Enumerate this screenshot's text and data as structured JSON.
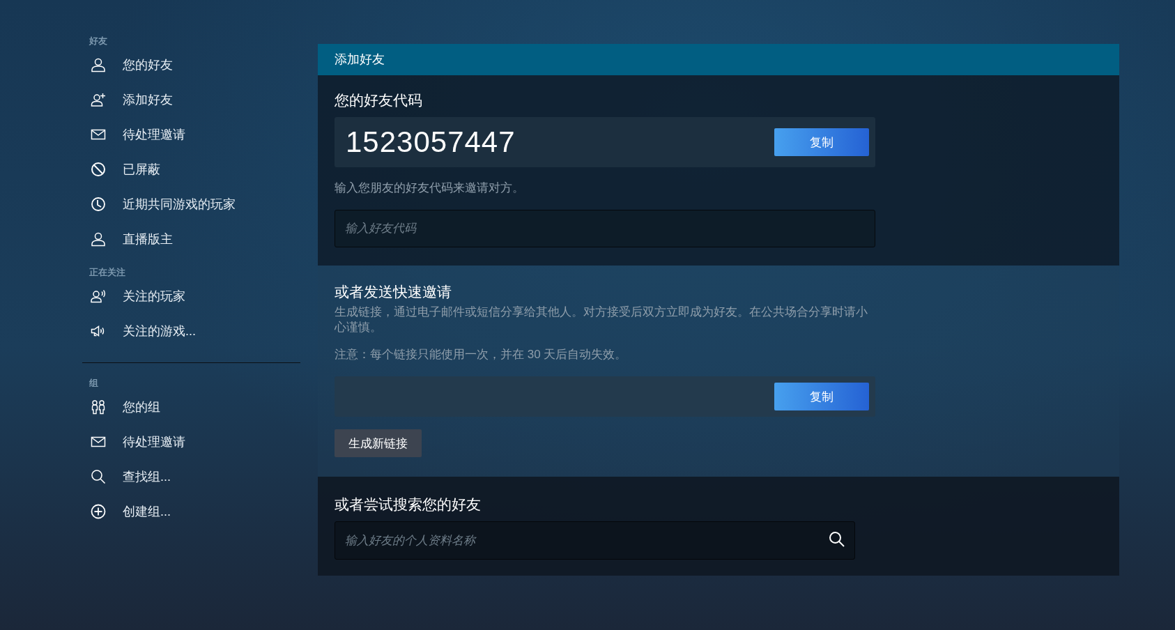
{
  "sidebar": {
    "sections": [
      {
        "title": "好友",
        "items": [
          {
            "label": "您的好友"
          },
          {
            "label": "添加好友"
          },
          {
            "label": "待处理邀请"
          },
          {
            "label": "已屏蔽"
          },
          {
            "label": "近期共同游戏的玩家"
          },
          {
            "label": "直播版主"
          }
        ]
      },
      {
        "title": "正在关注",
        "items": [
          {
            "label": "关注的玩家"
          },
          {
            "label": "关注的游戏..."
          }
        ]
      },
      {
        "title": "组",
        "items": [
          {
            "label": "您的组"
          },
          {
            "label": "待处理邀请"
          },
          {
            "label": "查找组..."
          },
          {
            "label": "创建组..."
          }
        ]
      }
    ]
  },
  "panel": {
    "title": "添加好友",
    "friend_code": {
      "heading": "您的好友代码",
      "code": "1523057447",
      "copy_button": "复制",
      "hint": "输入您朋友的好友代码来邀请对方。",
      "input_placeholder": "输入好友代码"
    },
    "quick_invite": {
      "heading": "或者发送快速邀请",
      "description": "生成链接，通过电子邮件或短信分享给其他人。对方接受后双方立即成为好友。在公共场合分享时请小心谨慎。",
      "note": "注意：每个链接只能使用一次，并在 30 天后自动失效。",
      "copy_button": "复制",
      "generate_button": "生成新链接"
    },
    "search": {
      "heading": "或者尝试搜索您的好友",
      "placeholder": "输入好友的个人资料名称"
    }
  }
}
